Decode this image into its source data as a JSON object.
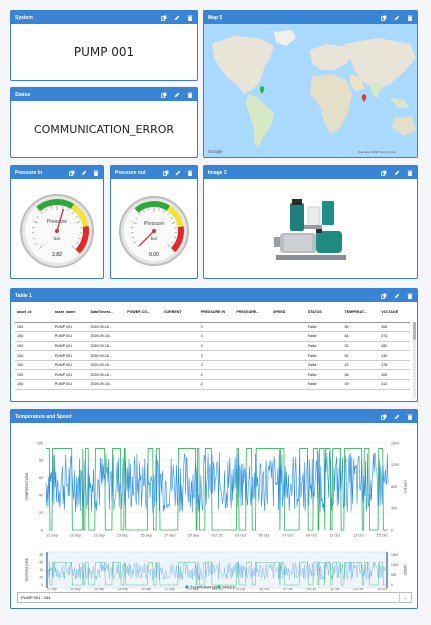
{
  "widgets": {
    "system": {
      "title": "System",
      "value": "PUMP 001"
    },
    "map": {
      "title": "Map 5",
      "attribution_left": "Google",
      "attribution_right": "Map data ©2020   Terms of Use"
    },
    "status": {
      "title": "Status",
      "value": "COMMUNICATION_ERROR"
    },
    "pressure_in": {
      "title": "Pressure In",
      "label": "Pressure",
      "unit": "bar",
      "value": "2.82",
      "fraction": 0.56
    },
    "pressure_out": {
      "title": "Pressure out",
      "label": "Pressure",
      "unit": "bar",
      "value": "0.00",
      "fraction": 0.0
    },
    "image": {
      "title": "Image 2"
    },
    "table": {
      "title": "Table 1",
      "columns": [
        "asset_id",
        "asset_name",
        "DataTimest...",
        "POWER CO...",
        "CURRENT",
        "PRESSURE IN",
        "PRESSURE...",
        "SPEED",
        "STATUS",
        "TEMPERAT...",
        "VOLTAGE"
      ],
      "rows": [
        [
          "154",
          "PUMP 001",
          "2020-09-16...",
          "",
          "",
          "3",
          "",
          "",
          "False",
          "50",
          "406"
        ],
        [
          "154",
          "PUMP 001",
          "2020-09-16...",
          "",
          "",
          "3",
          "",
          "",
          "False",
          "64",
          "373"
        ],
        [
          "154",
          "PUMP 001",
          "2020-09-16...",
          "",
          "",
          "4",
          "",
          "",
          "False",
          "33",
          "450"
        ],
        [
          "154",
          "PUMP 001",
          "2020-09-16...",
          "",
          "",
          "3",
          "",
          "",
          "False",
          "52",
          "430"
        ],
        [
          "154",
          "PUMP 001",
          "2020-09-16...",
          "",
          "",
          "3",
          "",
          "",
          "False",
          "43",
          "378"
        ],
        [
          "154",
          "PUMP 001",
          "2020-09-16...",
          "",
          "",
          "4",
          "",
          "",
          "False",
          "58",
          "405"
        ],
        [
          "154",
          "PUMP 001",
          "2020-09-16...",
          "",
          "",
          "2",
          "",
          "",
          "False",
          "39",
          "412"
        ]
      ]
    },
    "chart": {
      "title": "Temperature and Speed",
      "select_value": "PUMP 001 - 154",
      "legend": [
        "TEMPERATURE",
        "SPEED"
      ]
    }
  },
  "colors": {
    "header": "#3a84d6",
    "temperature": "#2a8fe0",
    "speed": "#2ab55a"
  },
  "icons": [
    "copy-icon",
    "edit-icon",
    "delete-icon"
  ],
  "chart_data": {
    "type": "line",
    "x_ticks": [
      "17 Sep",
      "19 Sep",
      "21 Sep",
      "23 Sep",
      "25 Sep",
      "27 Sep",
      "29 Sep",
      "Oct '20",
      "03 Oct",
      "05 Oct",
      "07 Oct",
      "09 Oct",
      "11 Oct",
      "13 Oct",
      "15 Oct"
    ],
    "left_axis": {
      "label": "TEMPERATURE",
      "ticks": [
        "100",
        "80",
        "60",
        "40",
        "20",
        "0"
      ],
      "ylim": [
        0,
        100
      ]
    },
    "right_axis": {
      "label": "SPEED",
      "ticks": [
        "1600",
        "1200",
        "800",
        "400",
        "0"
      ],
      "ylim": [
        0,
        1600
      ]
    },
    "nav_left_ticks": [
      "80",
      "60",
      "40",
      "20",
      "0"
    ],
    "nav_right_ticks": [
      "1500",
      "1000",
      "500",
      "0"
    ],
    "series": [
      {
        "name": "TEMPERATURE",
        "approx_range": [
          20,
          90
        ]
      },
      {
        "name": "SPEED",
        "approx_levels": [
          0,
          1500
        ]
      }
    ]
  }
}
